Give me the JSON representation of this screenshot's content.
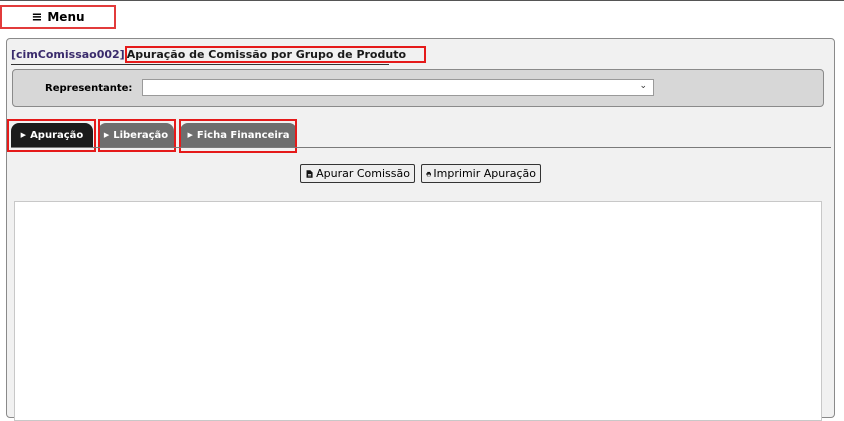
{
  "menu": {
    "label": "Menu",
    "icon": "hamburger-icon"
  },
  "panel": {
    "code": "[cimComissao002]",
    "title": "Apuração de Comissão por Grupo de Produto"
  },
  "filter": {
    "representante_label": "Representante:",
    "representante_value": ""
  },
  "tabs": [
    {
      "label": "Apuração",
      "active": true
    },
    {
      "label": "Liberação",
      "active": false
    },
    {
      "label": "Ficha Financeira",
      "active": false
    }
  ],
  "actions": {
    "apurar_label": "Apurar Comissão",
    "imprimir_label": "Imprimir Apuração"
  },
  "colors": {
    "highlight": "#e51a1a",
    "active_tab": "#1b1b1b",
    "inactive_tab": "#6e6e6e"
  }
}
